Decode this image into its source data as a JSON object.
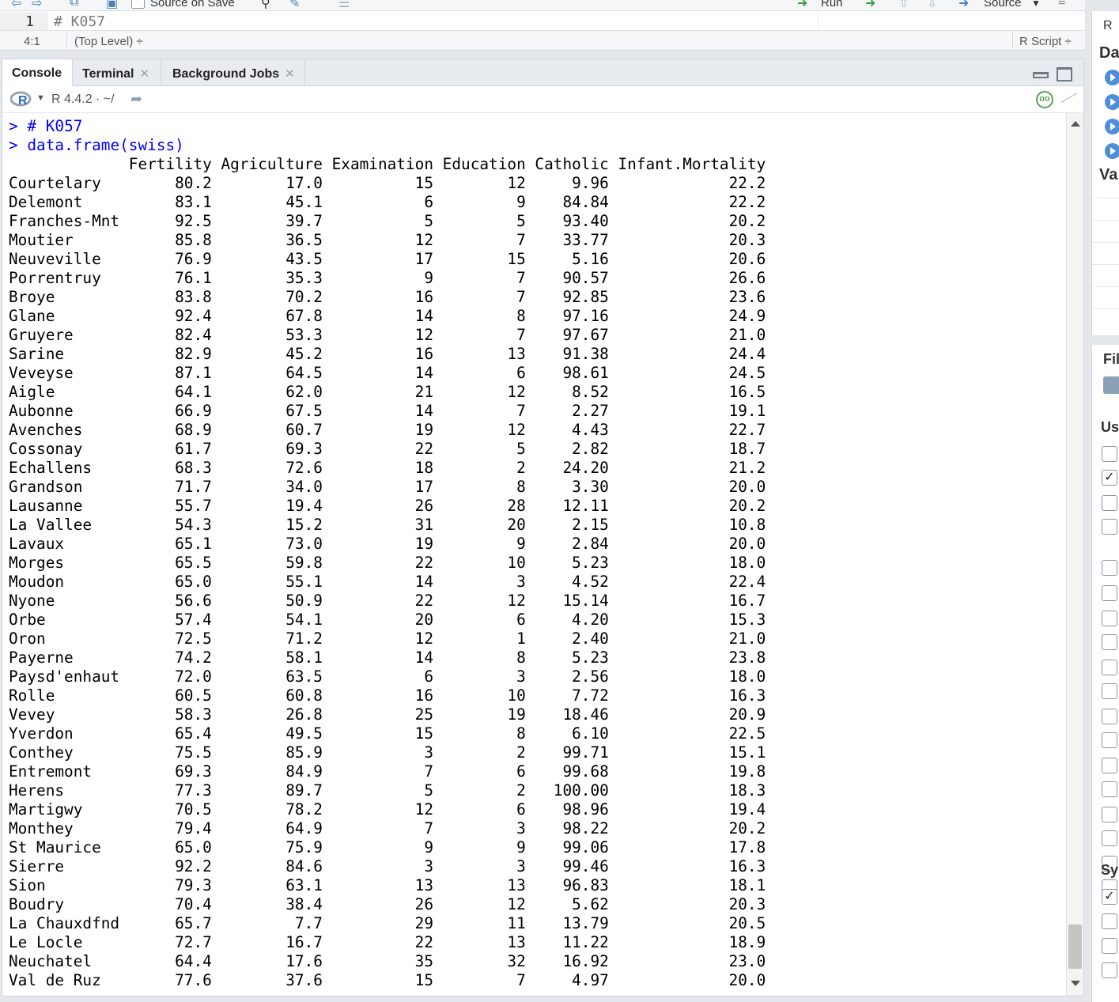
{
  "editor": {
    "toolbar": {
      "source_on_save": "Source on Save",
      "run": "Run",
      "source": "Source"
    },
    "line_number": "1",
    "code": "# K057",
    "status": {
      "cursor": "4:1",
      "scope": "(Top Level) ÷",
      "file_type": "R Script ÷"
    }
  },
  "console_pane": {
    "tabs": [
      {
        "label": "Console"
      },
      {
        "label": "Terminal"
      },
      {
        "label": "Background Jobs"
      }
    ],
    "header": {
      "version": "R 4.4.2 · ~/"
    },
    "prompt": ">",
    "commands": [
      "# K057",
      "data.frame(swiss)"
    ],
    "table": {
      "columns": [
        "Fertility",
        "Agriculture",
        "Examination",
        "Education",
        "Catholic",
        "Infant.Mortality"
      ],
      "rows": [
        [
          "Courtelary",
          "80.2",
          "17.0",
          "15",
          "12",
          "9.96",
          "22.2"
        ],
        [
          "Delemont",
          "83.1",
          "45.1",
          "6",
          "9",
          "84.84",
          "22.2"
        ],
        [
          "Franches-Mnt",
          "92.5",
          "39.7",
          "5",
          "5",
          "93.40",
          "20.2"
        ],
        [
          "Moutier",
          "85.8",
          "36.5",
          "12",
          "7",
          "33.77",
          "20.3"
        ],
        [
          "Neuveville",
          "76.9",
          "43.5",
          "17",
          "15",
          "5.16",
          "20.6"
        ],
        [
          "Porrentruy",
          "76.1",
          "35.3",
          "9",
          "7",
          "90.57",
          "26.6"
        ],
        [
          "Broye",
          "83.8",
          "70.2",
          "16",
          "7",
          "92.85",
          "23.6"
        ],
        [
          "Glane",
          "92.4",
          "67.8",
          "14",
          "8",
          "97.16",
          "24.9"
        ],
        [
          "Gruyere",
          "82.4",
          "53.3",
          "12",
          "7",
          "97.67",
          "21.0"
        ],
        [
          "Sarine",
          "82.9",
          "45.2",
          "16",
          "13",
          "91.38",
          "24.4"
        ],
        [
          "Veveyse",
          "87.1",
          "64.5",
          "14",
          "6",
          "98.61",
          "24.5"
        ],
        [
          "Aigle",
          "64.1",
          "62.0",
          "21",
          "12",
          "8.52",
          "16.5"
        ],
        [
          "Aubonne",
          "66.9",
          "67.5",
          "14",
          "7",
          "2.27",
          "19.1"
        ],
        [
          "Avenches",
          "68.9",
          "60.7",
          "19",
          "12",
          "4.43",
          "22.7"
        ],
        [
          "Cossonay",
          "61.7",
          "69.3",
          "22",
          "5",
          "2.82",
          "18.7"
        ],
        [
          "Echallens",
          "68.3",
          "72.6",
          "18",
          "2",
          "24.20",
          "21.2"
        ],
        [
          "Grandson",
          "71.7",
          "34.0",
          "17",
          "8",
          "3.30",
          "20.0"
        ],
        [
          "Lausanne",
          "55.7",
          "19.4",
          "26",
          "28",
          "12.11",
          "20.2"
        ],
        [
          "La Vallee",
          "54.3",
          "15.2",
          "31",
          "20",
          "2.15",
          "10.8"
        ],
        [
          "Lavaux",
          "65.1",
          "73.0",
          "19",
          "9",
          "2.84",
          "20.0"
        ],
        [
          "Morges",
          "65.5",
          "59.8",
          "22",
          "10",
          "5.23",
          "18.0"
        ],
        [
          "Moudon",
          "65.0",
          "55.1",
          "14",
          "3",
          "4.52",
          "22.4"
        ],
        [
          "Nyone",
          "56.6",
          "50.9",
          "22",
          "12",
          "15.14",
          "16.7"
        ],
        [
          "Orbe",
          "57.4",
          "54.1",
          "20",
          "6",
          "4.20",
          "15.3"
        ],
        [
          "Oron",
          "72.5",
          "71.2",
          "12",
          "1",
          "2.40",
          "21.0"
        ],
        [
          "Payerne",
          "74.2",
          "58.1",
          "14",
          "8",
          "5.23",
          "23.8"
        ],
        [
          "Paysd'enhaut",
          "72.0",
          "63.5",
          "6",
          "3",
          "2.56",
          "18.0"
        ],
        [
          "Rolle",
          "60.5",
          "60.8",
          "16",
          "10",
          "7.72",
          "16.3"
        ],
        [
          "Vevey",
          "58.3",
          "26.8",
          "25",
          "19",
          "18.46",
          "20.9"
        ],
        [
          "Yverdon",
          "65.4",
          "49.5",
          "15",
          "8",
          "6.10",
          "22.5"
        ],
        [
          "Conthey",
          "75.5",
          "85.9",
          "3",
          "2",
          "99.71",
          "15.1"
        ],
        [
          "Entremont",
          "69.3",
          "84.9",
          "7",
          "6",
          "99.68",
          "19.8"
        ],
        [
          "Herens",
          "77.3",
          "89.7",
          "5",
          "2",
          "100.00",
          "18.3"
        ],
        [
          "Martigwy",
          "70.5",
          "78.2",
          "12",
          "6",
          "98.96",
          "19.4"
        ],
        [
          "Monthey",
          "79.4",
          "64.9",
          "7",
          "3",
          "98.22",
          "20.2"
        ],
        [
          "St Maurice",
          "65.0",
          "75.9",
          "9",
          "9",
          "99.06",
          "17.8"
        ],
        [
          "Sierre",
          "92.2",
          "84.6",
          "3",
          "3",
          "99.46",
          "16.3"
        ],
        [
          "Sion",
          "79.3",
          "63.1",
          "13",
          "13",
          "96.83",
          "18.1"
        ],
        [
          "Boudry",
          "70.4",
          "38.4",
          "26",
          "12",
          "5.62",
          "20.3"
        ],
        [
          "La Chauxdfnd",
          "65.7",
          "7.7",
          "29",
          "11",
          "13.79",
          "20.5"
        ],
        [
          "Le Locle",
          "72.7",
          "16.7",
          "22",
          "13",
          "11.22",
          "18.9"
        ],
        [
          "Neuchatel",
          "64.4",
          "17.6",
          "35",
          "32",
          "16.92",
          "23.0"
        ],
        [
          "Val de Ruz",
          "77.6",
          "37.6",
          "15",
          "7",
          "4.97",
          "20.0"
        ]
      ]
    }
  },
  "right_panes": {
    "top": {
      "tab_fragment": "R",
      "section_1": "Da",
      "section_2": "Va"
    },
    "bottom": {
      "tab_fragment": "Fil",
      "section_user": "Us",
      "user_checks": [
        false,
        true,
        false,
        false,
        false,
        false,
        false,
        false,
        false,
        false,
        false,
        false,
        false,
        false,
        false,
        false,
        false,
        false
      ],
      "section_system": "Sy",
      "system_checks": [
        true,
        false,
        false,
        false
      ]
    }
  },
  "colors": {
    "accent": "#4d8fd6",
    "command": "#0000ff"
  }
}
